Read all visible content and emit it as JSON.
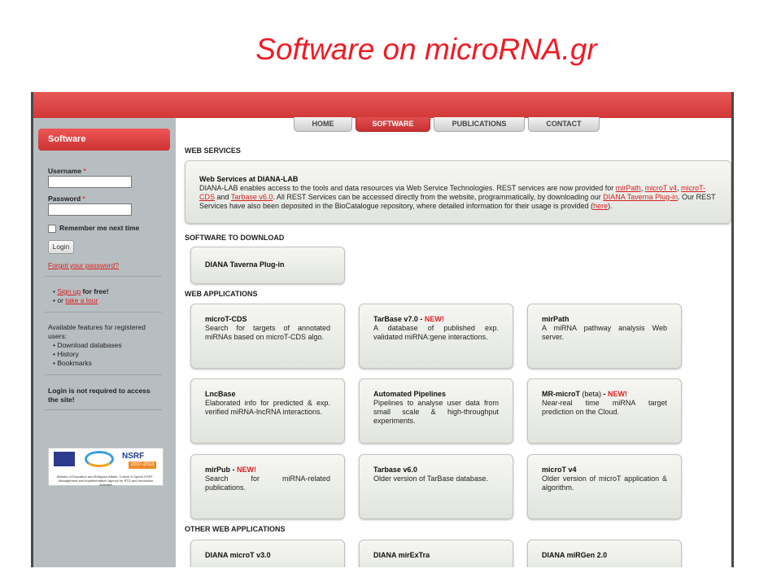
{
  "slide_title": "Software on  microRNA.gr",
  "nav": {
    "tabs": [
      "HOME",
      "SOFTWARE",
      "PUBLICATIONS",
      "CONTACT"
    ],
    "active": "SOFTWARE"
  },
  "sidebar": {
    "header": "Software",
    "username_label": "Username",
    "password_label": "Password",
    "required_mark": "*",
    "remember_label": "Remember me next time",
    "login_button": "Login",
    "forgot_link": "Forgot your password?",
    "signup_link": "Sign up",
    "signup_suffix": " for free!",
    "or_text": "or ",
    "tour_link": "take a tour",
    "features_intro": "Available features for registered users:",
    "features": [
      "Download databases",
      "History",
      "Bookmarks"
    ],
    "login_note": "Login is not required to access the site!",
    "logo_caption": "Ministry of Education and Religious Affairs, Culture & Sports GSRT - Management and Implementation Agency for RTD and Innovation Activities",
    "logo_nsrf": "NSRF",
    "logo_years": "2007-2013"
  },
  "sections": {
    "web_services": "WEB SERVICES",
    "software_download": "SOFTWARE TO DOWNLOAD",
    "web_apps": "WEB APPLICATIONS",
    "other_apps": "OTHER WEB APPLICATIONS"
  },
  "web_services": {
    "title": "Web Services at DIANA-LAB",
    "text_1": "DIANA-LAB enables access to the tools and data resources via Web Service Technologies. REST services are now provided for ",
    "link_mirpath": "mirPath",
    "sep_1": ", ",
    "link_microt": "microT v4",
    "sep_2": ", ",
    "link_microtcds": "microT-CDS",
    "text_and": " and ",
    "link_tarbase": "Tarbase v6.0",
    "text_2": ". All REST Services can be accessed directly from the website, programmatically, by downloading our ",
    "link_taverna": "DIANA Taverna Plug-in",
    "text_3": ". Our REST Services have also been deposited in the BioCatalogue repository, where detailed information for their usage is provided (",
    "link_here": "here",
    "text_4": ")."
  },
  "download": {
    "title": "DIANA Taverna Plug-in"
  },
  "web_apps": [
    {
      "title": "microT-CDS",
      "badge": "",
      "desc": "Search for targets of annotated miRNAs based on microT-CDS algo."
    },
    {
      "title": "TarBase v7.0",
      "badge": "NEW!",
      "desc": "A database of published exp. validated miRNA:gene interactions."
    },
    {
      "title": "mirPath",
      "badge": "",
      "desc": "A miRNA pathway analysis Web server."
    },
    {
      "title": "LncBase",
      "badge": "",
      "desc": "Elaborated info for predicted & exp. verified miRNA-lncRNA interactions."
    },
    {
      "title": "Automated Pipelines",
      "badge": "",
      "desc": "Pipelines to analyse user data from small scale & high-throughput experiments."
    },
    {
      "title": "MR-microT",
      "beta": "(beta)",
      "badge": "NEW!",
      "desc": "Near-real time miRNA target prediction on the Cloud."
    },
    {
      "title": "mirPub",
      "badge": "NEW!",
      "desc": "Search for miRNA-related publications."
    },
    {
      "title": "Tarbase v6.0",
      "badge": "",
      "desc": "Older version of TarBase database."
    },
    {
      "title": "microT v4",
      "badge": "",
      "desc": "Older version of microT application & algorithm."
    }
  ],
  "other_apps": [
    "DIANA microT v3.0",
    "DIANA mirExTra",
    "DIANA miRGen 2.0"
  ],
  "colors": {
    "accent_red": "#d23838",
    "sidebar_gray": "#b7bec1",
    "title_red": "#ee1c25"
  }
}
